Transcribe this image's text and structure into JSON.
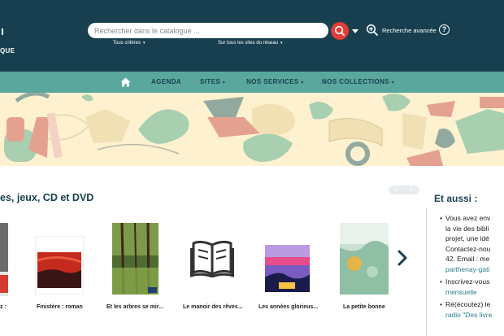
{
  "header": {
    "logo_text": "QUE",
    "search_placeholder": "Rechercher dans le catalogue ...",
    "criteria_label": "Tous critères",
    "sites_label": "Sur tous les sites du réseau",
    "advanced_search_label": "Recherche avancée",
    "help_label": "?",
    "icons": {
      "search": "search-icon",
      "dropdown": "chevron-down-icon",
      "advanced": "zoom-plus-icon",
      "help": "help-circle-icon"
    }
  },
  "nav": {
    "home_icon": "home-icon",
    "items": [
      {
        "label": "AGENDA",
        "caret": ""
      },
      {
        "label": "SITES",
        "caret": "▾"
      },
      {
        "label": "NOS SERVICES",
        "caret": "▾"
      },
      {
        "label": "NOS COLLECTIONS",
        "caret": "▾"
      }
    ]
  },
  "section": {
    "title": "es, jeux, CD et DVD",
    "pager_prev": "‹",
    "pager_next": "›",
    "books": [
      {
        "caption": "z :"
      },
      {
        "caption": "Finistère : roman",
        "cover_text": "Finistère"
      },
      {
        "caption": "Et les arbres se mir...",
        "cover_author": "GILBERT BORDES",
        "cover_title": "ET LES ARBRES SE MIRENT À CHANTER",
        "cover_badge": "XO"
      },
      {
        "caption": "Le manoir des rêves..."
      },
      {
        "caption": "Les années glorieus...",
        "cover_author": "Pierre Lemaitre",
        "cover_title": "Les années glorieuses"
      },
      {
        "caption": "La petite bonne",
        "cover_title_1": "La Petite",
        "cover_title_2": "Bonne",
        "cover_author": "Bérénice Pichat",
        "cover_publisher": "Les Avrils"
      }
    ],
    "next_icon": "chevron-right-icon"
  },
  "aside": {
    "title": "Et aussi :",
    "items": [
      {
        "lines": [
          "Vous avez env",
          "la vie des bibli",
          "projet, une idé",
          "Contactez-nou",
          "42. Email : me"
        ],
        "link": "parthenay-gati"
      },
      {
        "lines": [
          "Inscrivez-vous"
        ],
        "link": "mensuelle"
      },
      {
        "lines": [
          "Ré(écoutez) le"
        ],
        "link": "radio \"Des livre"
      }
    ]
  },
  "colors": {
    "header_bg": "#173f4f",
    "nav_bg": "#5aa79d",
    "search_button": "#e23d37",
    "banner_bg": "#fdf1cf",
    "title_color": "#173f4f"
  }
}
